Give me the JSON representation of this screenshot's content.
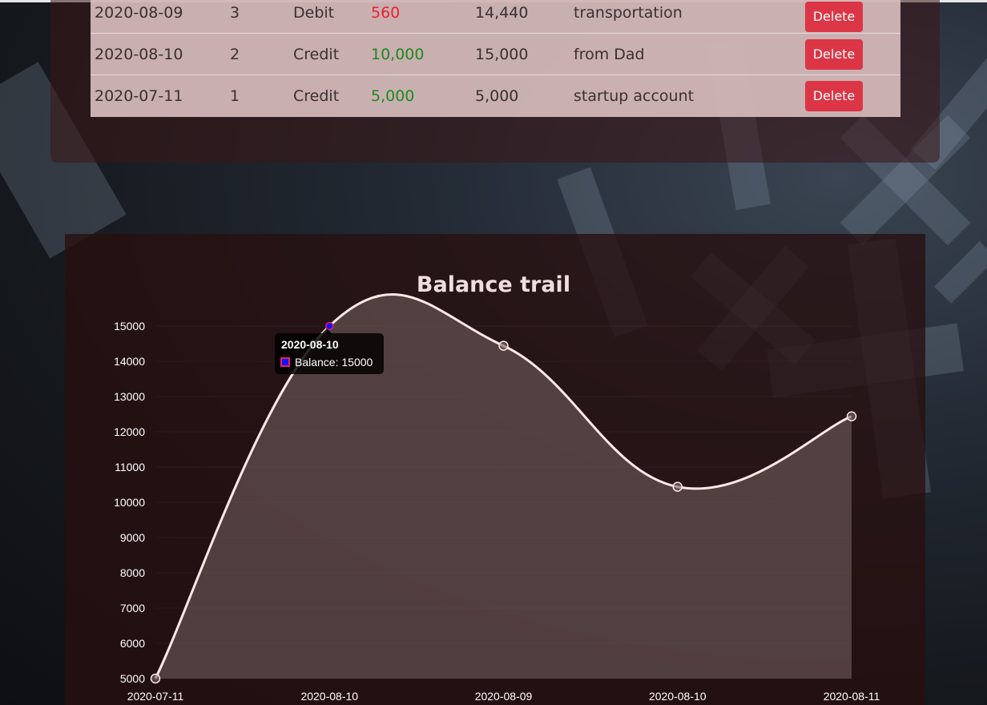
{
  "transactions": {
    "rows": [
      {
        "date": "2020-08-09",
        "id": "3",
        "type": "Debit",
        "amount": "560",
        "balance": "14,440",
        "note": "transportation",
        "delete_label": "Delete",
        "kind": "debit"
      },
      {
        "date": "2020-08-10",
        "id": "2",
        "type": "Credit",
        "amount": "10,000",
        "balance": "15,000",
        "note": "from Dad",
        "delete_label": "Delete",
        "kind": "credit"
      },
      {
        "date": "2020-07-11",
        "id": "1",
        "type": "Credit",
        "amount": "5,000",
        "balance": "5,000",
        "note": "startup account",
        "delete_label": "Delete",
        "kind": "credit"
      }
    ]
  },
  "chart_data": {
    "type": "line",
    "title": "Balance trail",
    "categories": [
      "2020-07-11",
      "2020-08-10",
      "2020-08-09",
      "2020-08-10",
      "2020-08-11"
    ],
    "series": [
      {
        "name": "Balance",
        "values": [
          5000,
          15000,
          14440,
          10440,
          12440
        ]
      }
    ],
    "y_ticks": [
      5000,
      6000,
      7000,
      8000,
      9000,
      10000,
      11000,
      12000,
      13000,
      14000,
      15000
    ],
    "ylim": [
      5000,
      15000
    ],
    "fill": true,
    "smooth": true,
    "tooltip": {
      "title": "2020-08-10",
      "label": "Balance",
      "value": "15000",
      "index": 1
    }
  },
  "colors": {
    "delete_button": "#dc3545",
    "debit_amount": "#e8222e",
    "credit_amount": "#1b8a1b",
    "line": "#ffe8e8",
    "fill": "rgba(120, 100, 100, 0.55)",
    "highlight_point": "#1010ff"
  }
}
